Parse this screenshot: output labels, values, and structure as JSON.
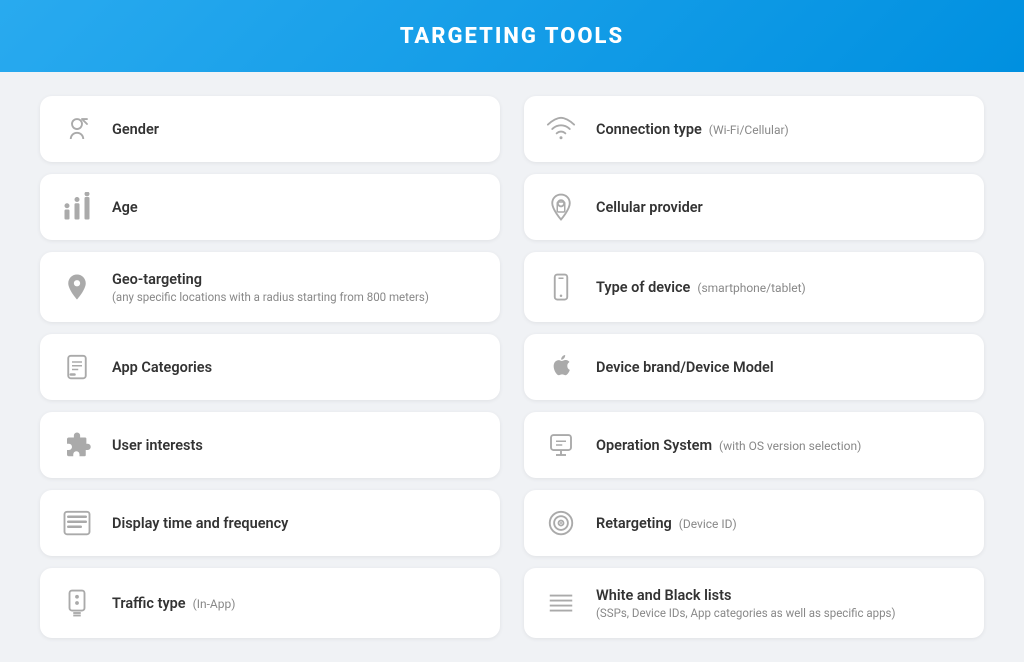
{
  "header": {
    "title": "TARGETING TOOLS"
  },
  "cards": [
    {
      "id": "gender",
      "label": "Gender",
      "sub": null,
      "small": null,
      "icon": "gender",
      "col": "left"
    },
    {
      "id": "connection-type",
      "label": "Connection type",
      "sub": null,
      "small": "(Wi-Fi/Cellular)",
      "icon": "wifi",
      "col": "right"
    },
    {
      "id": "age",
      "label": "Age",
      "sub": null,
      "small": null,
      "icon": "age",
      "col": "left"
    },
    {
      "id": "cellular-provider",
      "label": "Cellular provider",
      "sub": null,
      "small": null,
      "icon": "cellular",
      "col": "right"
    },
    {
      "id": "geo-targeting",
      "label": "Geo-targeting",
      "sub": "(any specific locations with a radius starting from 800 meters)",
      "small": null,
      "icon": "geo",
      "col": "left"
    },
    {
      "id": "type-of-device",
      "label": "Type of device",
      "sub": null,
      "small": "(smartphone/tablet)",
      "icon": "device",
      "col": "right"
    },
    {
      "id": "app-categories",
      "label": "App Categories",
      "sub": null,
      "small": null,
      "icon": "app",
      "col": "left"
    },
    {
      "id": "device-brand",
      "label": "Device brand/Device Model",
      "sub": null,
      "small": null,
      "icon": "apple",
      "col": "right"
    },
    {
      "id": "user-interests",
      "label": "User interests",
      "sub": null,
      "small": null,
      "icon": "puzzle",
      "col": "left"
    },
    {
      "id": "operation-system",
      "label": "Operation System",
      "sub": null,
      "small": "(with OS version selection)",
      "icon": "os",
      "col": "right"
    },
    {
      "id": "display-time",
      "label": "Display time and frequency",
      "sub": null,
      "small": null,
      "icon": "timer",
      "col": "left"
    },
    {
      "id": "retargeting",
      "label": "Retargeting",
      "sub": null,
      "small": "(Device ID)",
      "icon": "retarget",
      "col": "right"
    },
    {
      "id": "traffic-type",
      "label": "Traffic type",
      "sub": null,
      "small": "(In-App)",
      "icon": "traffic",
      "col": "left"
    },
    {
      "id": "white-black-lists",
      "label": "White and Black lists",
      "sub": "(SSPs, Device IDs, App categories as well as specific apps)",
      "small": null,
      "icon": "list",
      "col": "right"
    }
  ]
}
